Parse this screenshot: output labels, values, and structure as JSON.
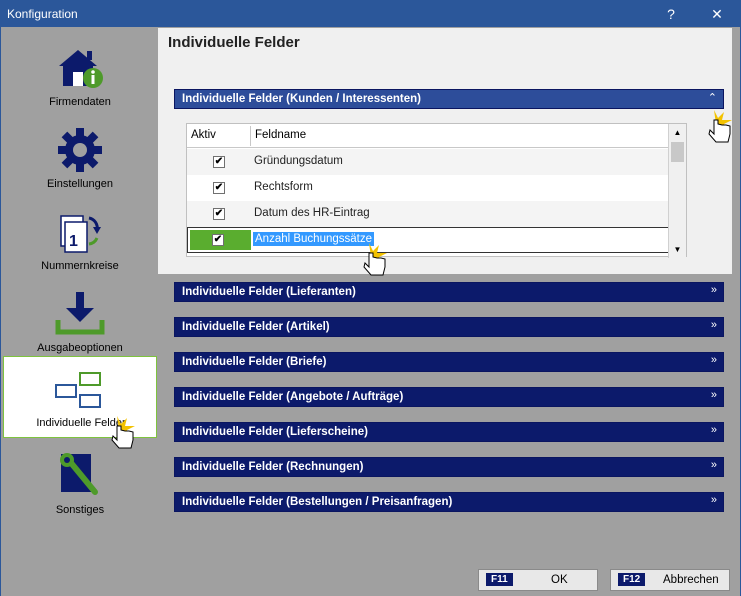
{
  "window": {
    "title": "Konfiguration",
    "help": "?",
    "close": "✕"
  },
  "sidebar": {
    "items": [
      {
        "label": "Firmendaten",
        "icon": "house-info-icon"
      },
      {
        "label": "Einstellungen",
        "icon": "gear-icon"
      },
      {
        "label": "Nummernkreise",
        "icon": "document-cycle-icon"
      },
      {
        "label": "Ausgabeoptionen",
        "icon": "download-icon"
      },
      {
        "label": "Individuelle Felder",
        "icon": "fields-icon",
        "active": true
      },
      {
        "label": "Sonstiges",
        "icon": "wrench-icon"
      }
    ]
  },
  "main": {
    "header": "Individuelle Felder",
    "expanded_section": {
      "title": "Individuelle Felder (Kunden / Interessenten)",
      "chevron": "⌃",
      "table": {
        "columns": [
          "Aktiv",
          "Feldname"
        ],
        "rows": [
          {
            "aktiv": true,
            "feldname": "Gründungsdatum"
          },
          {
            "aktiv": true,
            "feldname": "Rechtsform"
          },
          {
            "aktiv": true,
            "feldname": "Datum des HR-Eintrag"
          },
          {
            "aktiv": true,
            "feldname": "Anzahl Buchungssätze",
            "selected": true
          }
        ]
      }
    },
    "sections": [
      {
        "title": "Individuelle Felder (Lieferanten)"
      },
      {
        "title": "Individuelle Felder (Artikel)"
      },
      {
        "title": "Individuelle Felder (Briefe)"
      },
      {
        "title": "Individuelle Felder (Angebote / Aufträge)"
      },
      {
        "title": "Individuelle Felder (Lieferscheine)"
      },
      {
        "title": "Individuelle Felder (Rechnungen)"
      },
      {
        "title": "Individuelle Felder (Bestellungen / Preisanfragen)"
      }
    ],
    "chevron_collapsed": "»"
  },
  "footer": {
    "ok": {
      "key": "F11",
      "label": "OK"
    },
    "cancel": {
      "key": "F12",
      "label": "Abbrechen"
    }
  },
  "colors": {
    "titlebar": "#2b579a",
    "section_bar": "#0c1a6b",
    "accent_green": "#5aad2f",
    "selection_blue": "#3399ff"
  }
}
